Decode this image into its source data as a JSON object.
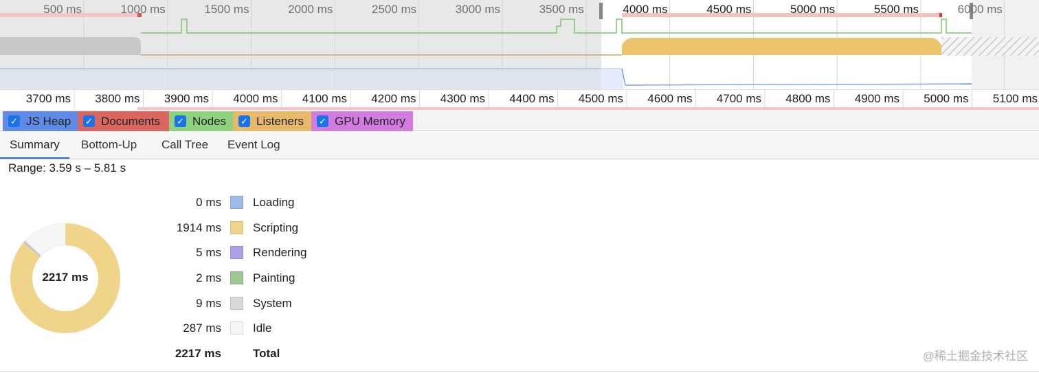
{
  "overview": {
    "time_labels": [
      "500 ms",
      "1000 ms",
      "1500 ms",
      "2000 ms",
      "2500 ms",
      "3000 ms",
      "3500 ms",
      "4000 ms",
      "4500 ms",
      "5000 ms",
      "5500 ms",
      "6000 ms"
    ],
    "selection_ms": [
      3590,
      5810
    ]
  },
  "ruler": {
    "time_labels": [
      "3700 ms",
      "3800 ms",
      "3900 ms",
      "4000 ms",
      "4100 ms",
      "4200 ms",
      "4300 ms",
      "4400 ms",
      "4500 ms",
      "4600 ms",
      "4700 ms",
      "4800 ms",
      "4900 ms",
      "5000 ms",
      "5100 ms"
    ]
  },
  "counters": [
    {
      "label": "JS Heap",
      "color": "#5f8be6",
      "checked": true
    },
    {
      "label": "Documents",
      "color": "#d9675f",
      "checked": true
    },
    {
      "label": "Nodes",
      "color": "#8ed27d",
      "checked": true
    },
    {
      "label": "Listeners",
      "color": "#e9b96b",
      "checked": true
    },
    {
      "label": "GPU Memory",
      "color": "#d27ce0",
      "checked": true
    }
  ],
  "tabs": [
    {
      "label": "Summary",
      "active": true
    },
    {
      "label": "Bottom-Up",
      "active": false
    },
    {
      "label": "Call Tree",
      "active": false
    },
    {
      "label": "Event Log",
      "active": false
    }
  ],
  "summary": {
    "range": "Range: 3.59 s – 5.81 s",
    "total_label": "2217 ms",
    "categories": [
      {
        "value": "0 ms",
        "ms": 0,
        "name": "Loading",
        "color": "#9dbbe8"
      },
      {
        "value": "1914 ms",
        "ms": 1914,
        "name": "Scripting",
        "color": "#f0d48a"
      },
      {
        "value": "5 ms",
        "ms": 5,
        "name": "Rendering",
        "color": "#af9ee8"
      },
      {
        "value": "2 ms",
        "ms": 2,
        "name": "Painting",
        "color": "#9ec793"
      },
      {
        "value": "9 ms",
        "ms": 9,
        "name": "System",
        "color": "#dadada"
      },
      {
        "value": "287 ms",
        "ms": 287,
        "name": "Idle",
        "color": "#f6f6f6"
      }
    ],
    "total": {
      "value": "2217 ms",
      "name": "Total"
    }
  },
  "watermark": "@稀土掘金技术社区"
}
